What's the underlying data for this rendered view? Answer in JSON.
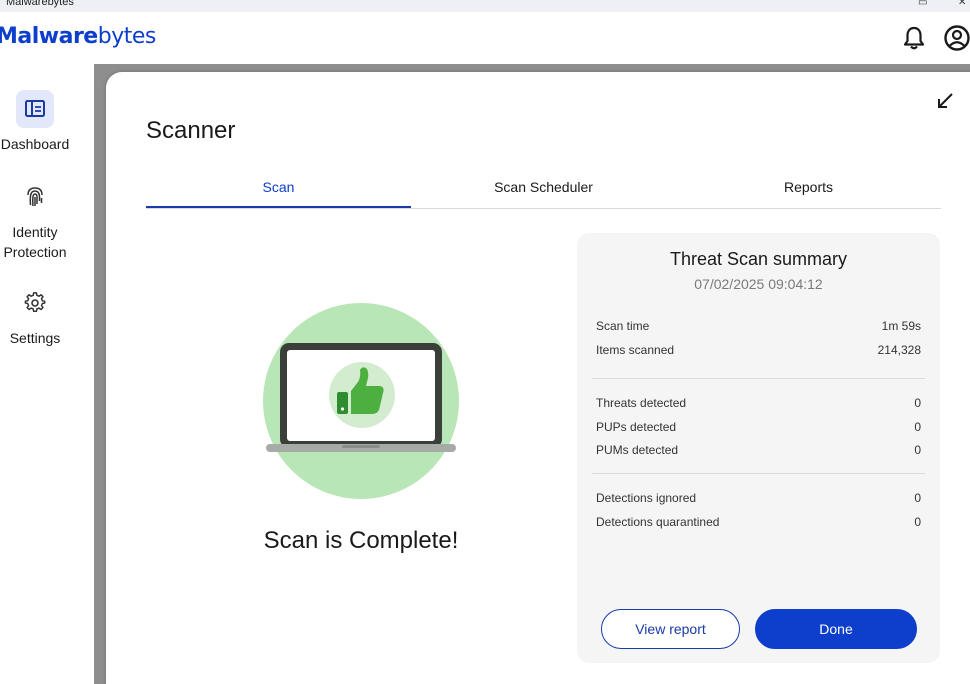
{
  "window": {
    "title": "Malwarebytes"
  },
  "header": {
    "logo_bold": "Malware",
    "logo_light": "bytes"
  },
  "sidebar": {
    "items": [
      {
        "label": "Dashboard",
        "icon": "dashboard-icon",
        "active": true
      },
      {
        "label_line1": "Identity",
        "label_line2": "Protection",
        "icon": "fingerprint-icon"
      },
      {
        "label": "Settings",
        "icon": "gear-icon"
      }
    ]
  },
  "scanner": {
    "title": "Scanner",
    "tabs": [
      {
        "label": "Scan",
        "active": true
      },
      {
        "label": "Scan Scheduler"
      },
      {
        "label": "Reports"
      }
    ],
    "status": "Scan is Complete!",
    "illustration_icon": "thumbs-up-laptop-icon"
  },
  "summary": {
    "title": "Threat Scan summary",
    "date": "07/02/2025 09:04:12",
    "groups": [
      [
        {
          "label": "Scan time",
          "value": "1m 59s"
        },
        {
          "label": "Items scanned",
          "value": "214,328"
        }
      ],
      [
        {
          "label": "Threats detected",
          "value": "0"
        },
        {
          "label": "PUPs detected",
          "value": "0"
        },
        {
          "label": "PUMs detected",
          "value": "0"
        }
      ],
      [
        {
          "label": "Detections ignored",
          "value": "0"
        },
        {
          "label": "Detections quarantined",
          "value": "0"
        }
      ]
    ],
    "view_report_label": "View report",
    "done_label": "Done"
  },
  "colors": {
    "brand": "#0d3ecc",
    "accent_dark": "#1a3aa8",
    "success_green": "#3cb043",
    "circle_green": "#b9e6b6"
  }
}
